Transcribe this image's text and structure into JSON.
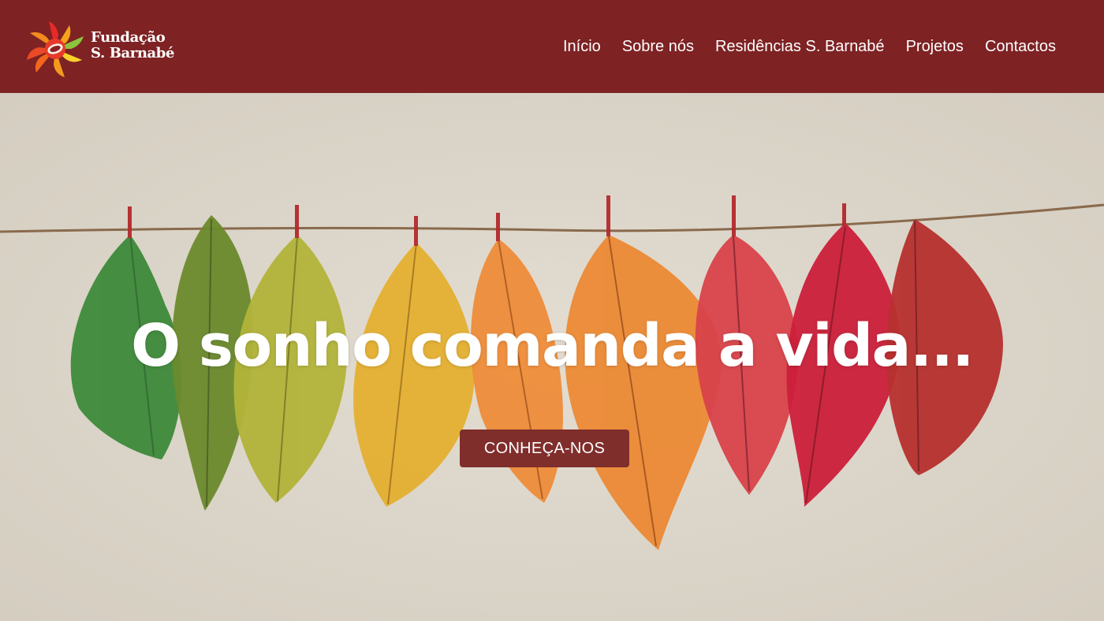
{
  "brand": {
    "name_line1": "Fundação",
    "name_line2": "S. Barnabé",
    "logo_icon": "sun-flower-logo-icon"
  },
  "nav": {
    "items": [
      {
        "label": "Início"
      },
      {
        "label": "Sobre nós"
      },
      {
        "label": "Residências S. Barnabé"
      },
      {
        "label": "Projetos"
      },
      {
        "label": "Contactos"
      }
    ]
  },
  "hero": {
    "headline": "O sonho comanda a vida...",
    "cta_label": "CONHEÇA-NOS",
    "background": "autumn-leaves-on-string-photo"
  },
  "colors": {
    "header_bg": "#7e2223",
    "cta_bg": "#7f2e2c",
    "hero_wall": "#dcd6cb",
    "text": "#ffffff"
  }
}
